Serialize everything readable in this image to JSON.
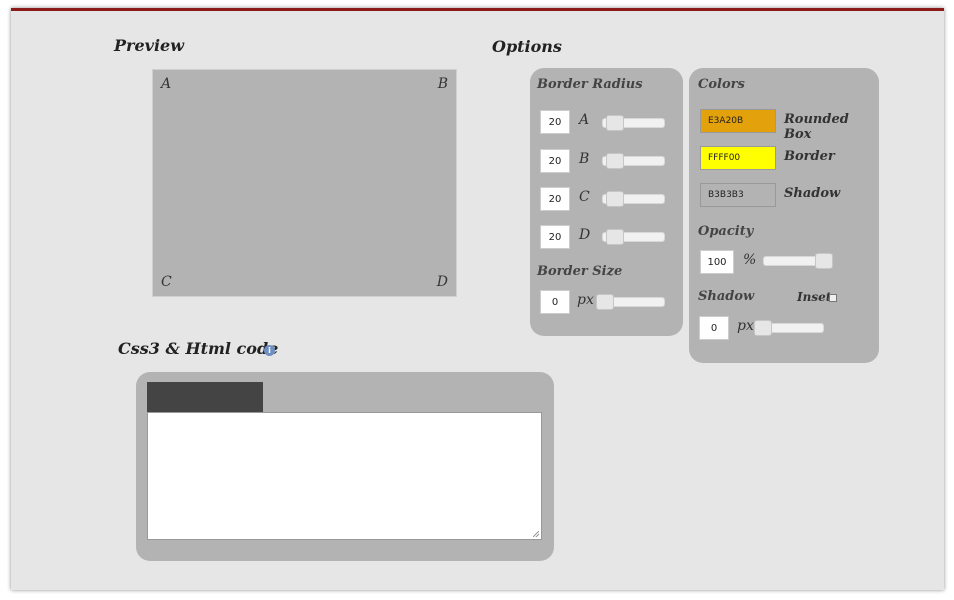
{
  "preview": {
    "title": "Preview",
    "corners": {
      "a": "A",
      "b": "B",
      "c": "C",
      "d": "D"
    }
  },
  "options": {
    "title": "Options"
  },
  "border_radius": {
    "title": "Border Radius",
    "rows": [
      {
        "value": "20",
        "label": "A"
      },
      {
        "value": "20",
        "label": "B"
      },
      {
        "value": "20",
        "label": "C"
      },
      {
        "value": "20",
        "label": "D"
      }
    ]
  },
  "border_size": {
    "title": "Border Size",
    "value": "0",
    "unit": "px"
  },
  "colors": {
    "title": "Colors",
    "items": [
      {
        "hex": "E3A20B",
        "swatch": "#e3a20b",
        "label": "Rounded Box"
      },
      {
        "hex": "FFFF00",
        "swatch": "#ffff00",
        "label": "Border"
      },
      {
        "hex": "B3B3B3",
        "swatch": "#b3b3b3",
        "label": "Shadow"
      }
    ]
  },
  "opacity": {
    "title": "Opacity",
    "value": "100",
    "unit": "%"
  },
  "shadow": {
    "title": "Shadow",
    "inset_label": "Inset",
    "value": "0",
    "unit": "px"
  },
  "code": {
    "title": "Css3 & Html code"
  },
  "theme": {
    "accent": "#8b1a1a",
    "panel": "#b3b3b3",
    "background": "#e6e6e6"
  }
}
